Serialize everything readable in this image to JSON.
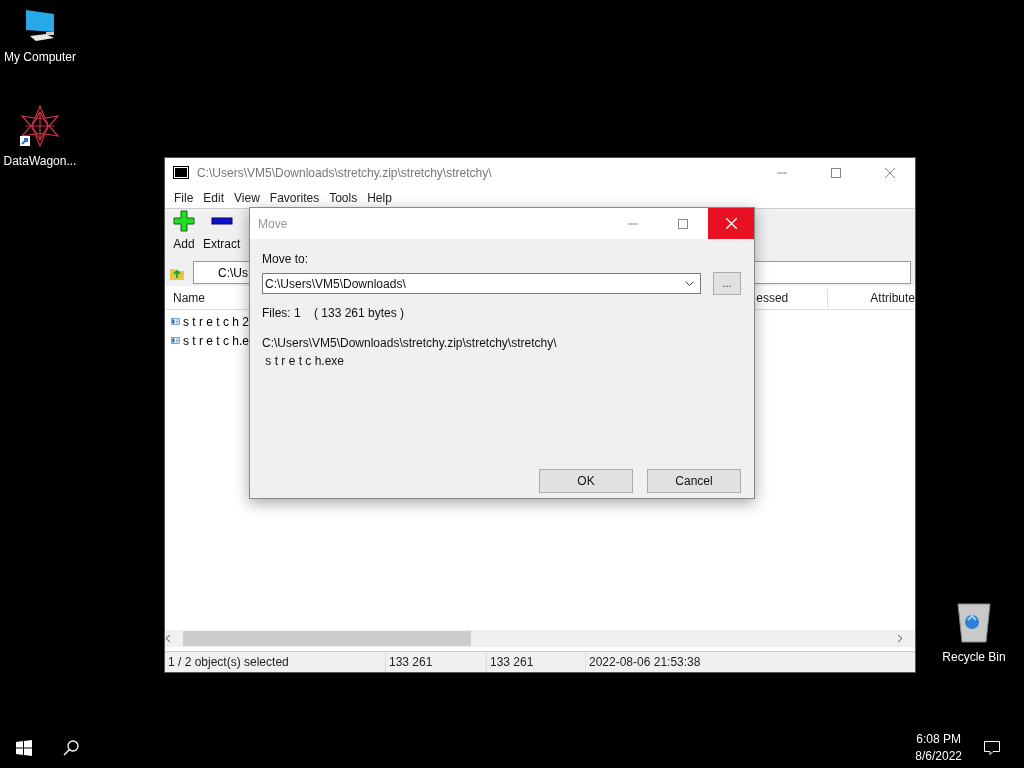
{
  "desktop_icons": [
    {
      "kind": "computer",
      "label": "My Computer"
    },
    {
      "kind": "app",
      "label": "DataWagon..."
    },
    {
      "kind": "recycle",
      "label": "Recycle Bin"
    }
  ],
  "main_window": {
    "title": "C:\\Users\\VM5\\Downloads\\stretchy.zip\\stretchy\\stretchy\\",
    "menu": [
      "File",
      "Edit",
      "View",
      "Favorites",
      "Tools",
      "Help"
    ],
    "toolbar": [
      {
        "kind": "add",
        "label": "Add"
      },
      {
        "kind": "extract",
        "label": "Extract"
      }
    ],
    "address": "C:\\Us",
    "columns": [
      "Name",
      "essed",
      "Attribute"
    ],
    "files": [
      {
        "name": "s t r e t c h 2",
        "selected": false
      },
      {
        "name": "s t r e t c h.e",
        "selected": false
      }
    ],
    "status_bar": [
      "1 / 2 object(s) selected",
      "133 261",
      "133 261",
      "2022-08-06 21:53:38"
    ]
  },
  "dialog": {
    "title": "Move",
    "move_to_label": "Move to:",
    "path": "C:\\Users\\VM5\\Downloads\\",
    "browse": "...",
    "files_info": "Files: 1    ( 133 261 bytes )",
    "source": "C:\\Users\\VM5\\Downloads\\stretchy.zip\\stretchy\\stretchy\\",
    "file": " s t r e t c h.exe",
    "buttons": [
      "OK",
      "Cancel"
    ]
  },
  "taskbar": {
    "time": "6:08 PM",
    "date": "8/6/2022"
  }
}
